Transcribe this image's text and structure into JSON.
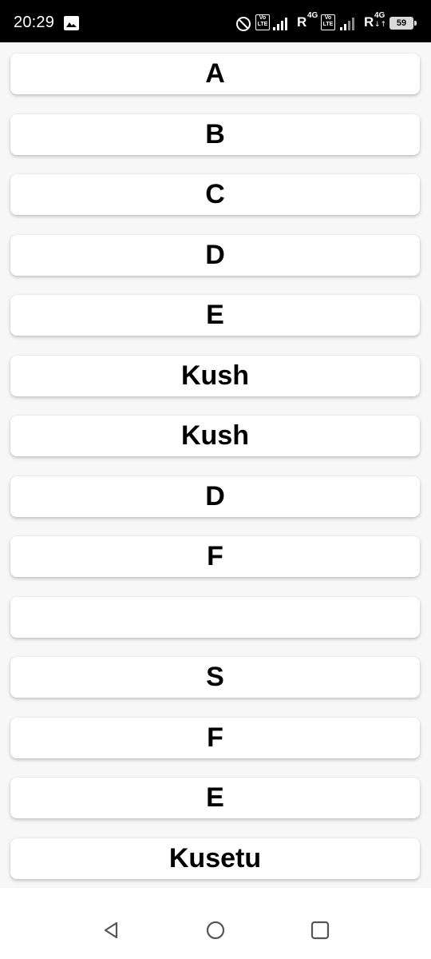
{
  "status_bar": {
    "time": "20:29",
    "volte_label": "Vo LTE",
    "roaming": "R",
    "network_type": "4G",
    "battery_level": "59"
  },
  "list": {
    "items": [
      "A",
      "B",
      "C",
      "D",
      "E",
      "Kush",
      "Kush",
      "D",
      "F",
      "",
      "S",
      "F",
      "E",
      "Kusetu"
    ]
  },
  "navigation": {
    "back_icon": "triangle-back-icon",
    "home_icon": "circle-home-icon",
    "recents_icon": "square-recents-icon"
  }
}
